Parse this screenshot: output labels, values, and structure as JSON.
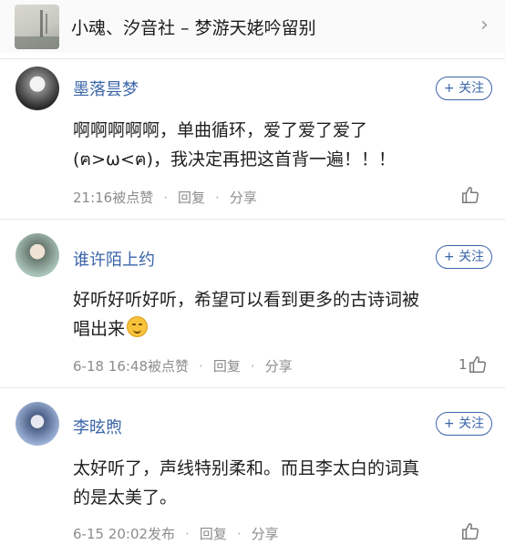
{
  "header": {
    "title": "小魂、汐音社 – 梦游天姥吟留别",
    "chevron_icon": "chevron-right-icon"
  },
  "comments": [
    {
      "username": "墨落昙梦",
      "follow_label": "+ 关注",
      "lines": [
        "啊啊啊啊啊，单曲循环，爱了爱了爱了",
        "(ฅ>ω<ฅ)，我决定再把这首背一遍！！！"
      ],
      "time": "21:16被点赞",
      "reply_label": "回复",
      "share_label": "分享",
      "like_count": ""
    },
    {
      "username": "谁许陌上约",
      "follow_label": "+ 关注",
      "lines": [
        "好听好听好听，希望可以看到更多的古诗词被",
        "唱出来"
      ],
      "emoji": "smile-emoji",
      "time": "6-18 16:48被点赞",
      "reply_label": "回复",
      "share_label": "分享",
      "like_count": "1"
    },
    {
      "username": "李昡煦",
      "follow_label": "+ 关注",
      "lines": [
        "太好听了，声线特别柔和。而且李太白的词真",
        "的是太美了。"
      ],
      "time": "6-15 20:02发布",
      "reply_label": "回复",
      "share_label": "分享",
      "like_count": ""
    }
  ],
  "colors": {
    "accent": "#3b65a8",
    "meta_text": "#8c8c8c",
    "body_text": "#1f1f1f"
  }
}
